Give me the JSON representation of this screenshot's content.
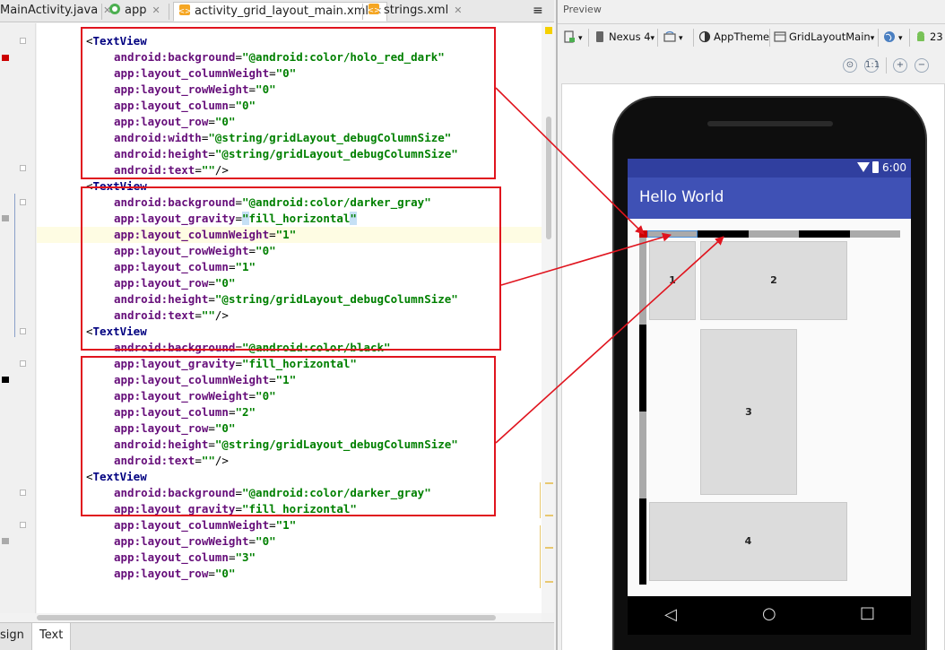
{
  "editor": {
    "tabs": [
      {
        "label": "MainActivity.java",
        "active": false
      },
      {
        "label": "app",
        "active": false
      },
      {
        "label": "activity_grid_layout_main.xml",
        "active": true
      },
      {
        "label": "strings.xml",
        "active": false
      }
    ],
    "tab_overflow": "≡",
    "code_lines": [
      {
        "tag": "TextView"
      },
      {
        "attr": "android:background",
        "value": "@android:color/holo_red_dark"
      },
      {
        "attr": "app:layout_columnWeight",
        "value": "0"
      },
      {
        "attr": "app:layout_rowWeight",
        "value": "0"
      },
      {
        "attr": "app:layout_column",
        "value": "0"
      },
      {
        "attr": "app:layout_row",
        "value": "0"
      },
      {
        "attr": "android:width",
        "value": "@string/gridLayout_debugColumnSize"
      },
      {
        "attr": "android:height",
        "value": "@string/gridLayout_debugColumnSize"
      },
      {
        "attr": "android:text",
        "value": "",
        "close": "/>"
      },
      {
        "tag": "TextView"
      },
      {
        "attr": "android:background",
        "value": "@android:color/darker_gray"
      },
      {
        "attr": "app:layout_gravity",
        "value": "fill_horizontal",
        "caret": true
      },
      {
        "attr": "app:layout_columnWeight",
        "value": "1"
      },
      {
        "attr": "app:layout_rowWeight",
        "value": "0"
      },
      {
        "attr": "app:layout_column",
        "value": "1"
      },
      {
        "attr": "app:layout_row",
        "value": "0"
      },
      {
        "attr": "android:height",
        "value": "@string/gridLayout_debugColumnSize"
      },
      {
        "attr": "android:text",
        "value": "",
        "close": "/>"
      },
      {
        "tag": "TextView"
      },
      {
        "attr": "android:background",
        "value": "@android:color/black"
      },
      {
        "attr": "app:layout_gravity",
        "value": "fill_horizontal"
      },
      {
        "attr": "app:layout_columnWeight",
        "value": "1"
      },
      {
        "attr": "app:layout_rowWeight",
        "value": "0"
      },
      {
        "attr": "app:layout_column",
        "value": "2"
      },
      {
        "attr": "app:layout_row",
        "value": "0"
      },
      {
        "attr": "android:height",
        "value": "@string/gridLayout_debugColumnSize"
      },
      {
        "attr": "android:text",
        "value": "",
        "close": "/>"
      },
      {
        "tag": "TextView"
      },
      {
        "attr": "android:background",
        "value": "@android:color/darker_gray"
      },
      {
        "attr": "app:layout_gravity",
        "value": "fill_horizontal"
      },
      {
        "attr": "app:layout_columnWeight",
        "value": "1"
      },
      {
        "attr": "app:layout_rowWeight",
        "value": "0"
      },
      {
        "attr": "app:layout_column",
        "value": "3"
      },
      {
        "attr": "app:layout_row",
        "value": "0"
      }
    ],
    "bottom_tabs": [
      {
        "label": "sign",
        "active": false
      },
      {
        "label": "Text",
        "active": true
      }
    ]
  },
  "preview": {
    "title": "Preview",
    "toolbar": {
      "device": "Nexus 4",
      "theme": "AppTheme",
      "activity": "GridLayoutMain",
      "api": "23"
    },
    "phone": {
      "time": "6:00",
      "app_title": "Hello World",
      "cells": [
        "1",
        "2",
        "3",
        "4"
      ]
    }
  },
  "colors": {
    "annotation_red": "#e0141e",
    "app_bar": "#3f51b5",
    "status_bar": "#303f9f",
    "darker_gray": "#aaaaaa",
    "black": "#000000",
    "holo_red_dark": "#cc0000"
  }
}
